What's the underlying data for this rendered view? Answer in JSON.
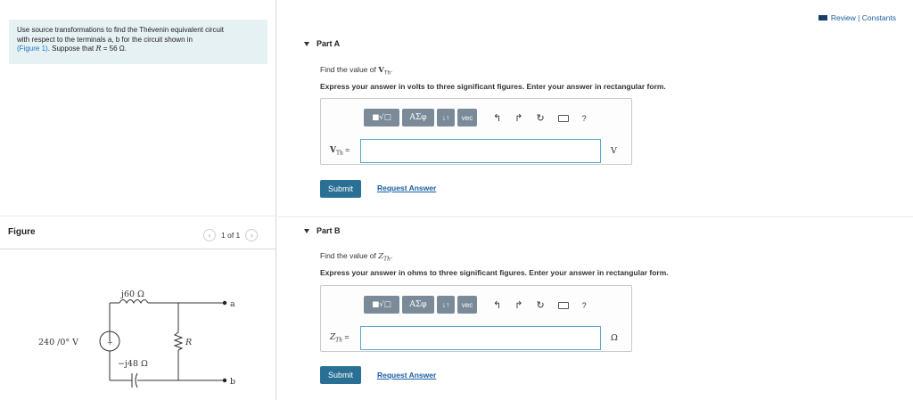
{
  "intro": {
    "line1": "Use source transformations to find the Thévenin equivalent circuit",
    "line2": "with respect to the terminals a, b for the circuit shown in",
    "link": "(Figure 1)",
    "line3_rest": ". Suppose that ",
    "r_sym": "R",
    "r_val": " = 56 Ω."
  },
  "figure": {
    "title": "Figure",
    "pager_text": "1 of 1"
  },
  "circuit": {
    "inductor_label": "j60 Ω",
    "source_label": "240 /0° V",
    "source_plus": "+",
    "resistor_label": "R",
    "capacitor_label": "−j48 Ω",
    "terminal_a": "a",
    "terminal_b": "b"
  },
  "header": {
    "review_label": "Review | Constants"
  },
  "partA": {
    "title": "Part A",
    "find_prefix": "Find the value of ",
    "find_symbol": "V",
    "find_sub": "Th",
    "find_suffix": ".",
    "express": "Express your answer in volts to three significant figures. Enter your answer in rectangular form.",
    "var_symbol": "V",
    "var_sub": "Th",
    "var_eq": " =",
    "unit": "V",
    "answer_value": "",
    "submit_label": "Submit",
    "request_label": "Request Answer"
  },
  "partB": {
    "title": "Part B",
    "find_prefix": "Find the value of ",
    "find_symbol": "Z",
    "find_sub": "Th",
    "find_suffix": ".",
    "express": "Express your answer in ohms to three significant figures. Enter your answer in rectangular form.",
    "var_symbol": "Z",
    "var_sub": "Th",
    "var_eq": " =",
    "unit": "Ω",
    "answer_value": "",
    "submit_label": "Submit",
    "request_label": "Request Answer"
  },
  "toolbar": {
    "matrix_label": "■√□",
    "greek_label": "ΑΣφ",
    "arrows_label": "↓↑",
    "vec_label": "vec",
    "undo_icon": "↰",
    "redo_icon": "↱",
    "reset_icon": "↻",
    "help_label": "?"
  }
}
